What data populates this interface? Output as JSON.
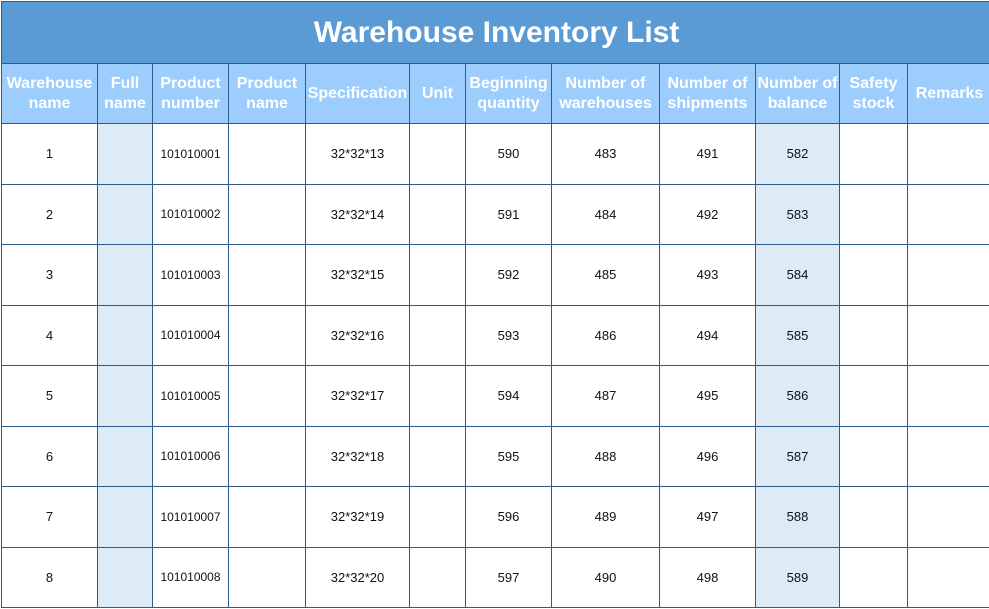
{
  "title": "Warehouse Inventory List",
  "columns": [
    {
      "line1": "Warehouse",
      "line2": "name"
    },
    {
      "line1": "Full",
      "line2": "name"
    },
    {
      "line1": "Product",
      "line2": "number"
    },
    {
      "line1": "Product",
      "line2": "name"
    },
    {
      "line1": "Specification",
      "line2": ""
    },
    {
      "line1": "Unit",
      "line2": ""
    },
    {
      "line1": "Beginning",
      "line2": "quantity"
    },
    {
      "line1": "Number of",
      "line2": "warehouses"
    },
    {
      "line1": "Number of",
      "line2": "shipments"
    },
    {
      "line1": "Number of",
      "line2": "balance"
    },
    {
      "line1": "Safety",
      "line2": "stock"
    },
    {
      "line1": "Remarks",
      "line2": ""
    }
  ],
  "rows": [
    {
      "warehouse": "1",
      "full_name": "",
      "product_number": "101010001",
      "product_name": "",
      "spec": "32*32*13",
      "unit": "",
      "beginning": "590",
      "in": "483",
      "out": "491",
      "balance": "582",
      "safety": "",
      "remarks": ""
    },
    {
      "warehouse": "2",
      "full_name": "",
      "product_number": "101010002",
      "product_name": "",
      "spec": "32*32*14",
      "unit": "",
      "beginning": "591",
      "in": "484",
      "out": "492",
      "balance": "583",
      "safety": "",
      "remarks": ""
    },
    {
      "warehouse": "3",
      "full_name": "",
      "product_number": "101010003",
      "product_name": "",
      "spec": "32*32*15",
      "unit": "",
      "beginning": "592",
      "in": "485",
      "out": "493",
      "balance": "584",
      "safety": "",
      "remarks": ""
    },
    {
      "warehouse": "4",
      "full_name": "",
      "product_number": "101010004",
      "product_name": "",
      "spec": "32*32*16",
      "unit": "",
      "beginning": "593",
      "in": "486",
      "out": "494",
      "balance": "585",
      "safety": "",
      "remarks": ""
    },
    {
      "warehouse": "5",
      "full_name": "",
      "product_number": "101010005",
      "product_name": "",
      "spec": "32*32*17",
      "unit": "",
      "beginning": "594",
      "in": "487",
      "out": "495",
      "balance": "586",
      "safety": "",
      "remarks": ""
    },
    {
      "warehouse": "6",
      "full_name": "",
      "product_number": "101010006",
      "product_name": "",
      "spec": "32*32*18",
      "unit": "",
      "beginning": "595",
      "in": "488",
      "out": "496",
      "balance": "587",
      "safety": "",
      "remarks": ""
    },
    {
      "warehouse": "7",
      "full_name": "",
      "product_number": "101010007",
      "product_name": "",
      "spec": "32*32*19",
      "unit": "",
      "beginning": "596",
      "in": "489",
      "out": "497",
      "balance": "588",
      "safety": "",
      "remarks": ""
    },
    {
      "warehouse": "8",
      "full_name": "",
      "product_number": "101010008",
      "product_name": "",
      "spec": "32*32*20",
      "unit": "",
      "beginning": "597",
      "in": "490",
      "out": "498",
      "balance": "589",
      "safety": "",
      "remarks": ""
    }
  ],
  "colors": {
    "title_bg": "#5b9bd5",
    "header_bg": "#9ccdfc",
    "shade": "#ddebf7",
    "border": "#2e5a8a"
  }
}
